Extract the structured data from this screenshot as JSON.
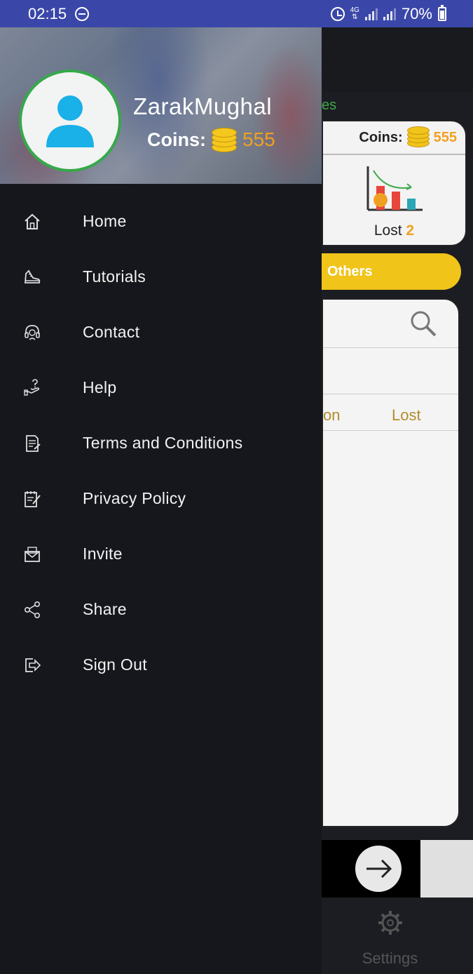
{
  "status_bar": {
    "time": "02:15",
    "network": "4G",
    "battery": "70%"
  },
  "drawer": {
    "user": {
      "name": "ZarakMughal",
      "coins_label": "Coins:",
      "coins_value": "555"
    },
    "menu": [
      {
        "label": "Home",
        "icon": "home-icon"
      },
      {
        "label": "Tutorials",
        "icon": "sneaker-icon"
      },
      {
        "label": "Contact",
        "icon": "headset-icon"
      },
      {
        "label": "Help",
        "icon": "hand-help-icon"
      },
      {
        "label": "Terms and Conditions",
        "icon": "document-icon"
      },
      {
        "label": "Privacy Policy",
        "icon": "notepad-icon"
      },
      {
        "label": "Invite",
        "icon": "envelope-icon"
      },
      {
        "label": "Share",
        "icon": "share-icon"
      },
      {
        "label": "Sign Out",
        "icon": "sign-out-icon"
      }
    ]
  },
  "background": {
    "tab_partial": "es",
    "coins_label": "Coins:",
    "coins_value": "555",
    "lost_label": "Lost",
    "lost_value": "2",
    "others_label": "Others",
    "col_partial": "on",
    "col_lost": "Lost",
    "settings_label": "Settings"
  },
  "colors": {
    "status_bar": "#3a47a8",
    "drawer_bg": "#15171c",
    "avatar_ring": "#36a84a",
    "coin_accent": "#f0a020",
    "others_yellow": "#f0c419"
  }
}
